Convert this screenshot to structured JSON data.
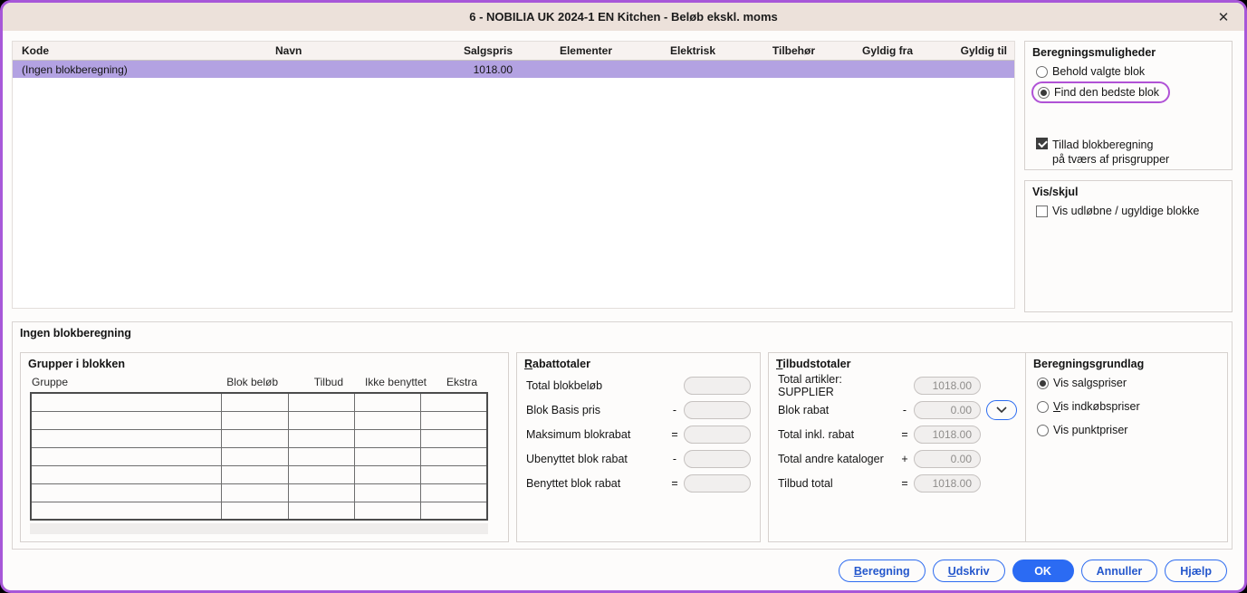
{
  "dialog": {
    "title": "6 - NOBILIA UK 2024-1 EN Kitchen - Beløb ekskl. moms",
    "close_icon": "✕"
  },
  "colors": {
    "accent_purple": "#a757d8",
    "selection_purple": "#b3a2e2",
    "primary_blue": "#2b6bf3",
    "titlebar_beige": "#ece1da"
  },
  "block_list": {
    "columns": [
      "Kode",
      "Navn",
      "Salgspris",
      "Elementer",
      "Elektrisk",
      "Tilbehør",
      "Gyldig fra",
      "Gyldig til"
    ],
    "rows": [
      {
        "kode": "(Ingen blokberegning)",
        "navn": "",
        "salgspris": "1018.00",
        "elementer": "",
        "elektrisk": "",
        "tilbehor": "",
        "gyldig_fra": "",
        "gyldig_til": "",
        "selected": true
      }
    ]
  },
  "beregningsmuligheder": {
    "title": "Beregningsmuligheder",
    "options": [
      {
        "label": "Behold valgte blok",
        "selected": false,
        "highlighted": false
      },
      {
        "label": "Find den bedste blok",
        "selected": true,
        "highlighted": true
      }
    ],
    "checkbox": {
      "line1": "Tillad blokberegning",
      "line2": "på tværs af prisgrupper",
      "checked": true
    }
  },
  "vis_skjul": {
    "title": "Vis/skjul",
    "checkbox": {
      "label": "Vis udløbne / ugyldige blokke",
      "checked": false
    }
  },
  "detail_panel": {
    "title": "Ingen blokberegning",
    "grupper": {
      "title": "Grupper i blokken",
      "columns": [
        "Gruppe",
        "Blok beløb",
        "Tilbud",
        "Ikke benyttet",
        "Ekstra"
      ],
      "row_count": 7,
      "rows": []
    },
    "rabattotaler": {
      "title": "Rabattotaler",
      "rows": [
        {
          "label": "Total blokbeløb",
          "op": "",
          "value": ""
        },
        {
          "label": "Blok Basis pris",
          "op": "-",
          "value": ""
        },
        {
          "label": "Maksimum blokrabat",
          "op": "=",
          "value": ""
        },
        {
          "label": "Ubenyttet blok rabat",
          "op": "-",
          "value": ""
        },
        {
          "label": "Benyttet blok rabat",
          "op": "=",
          "value": ""
        }
      ]
    },
    "tilbudstotaler": {
      "title": "Tilbudstotaler",
      "rows": [
        {
          "label": "Total artikler: SUPPLIER",
          "op": "",
          "value": "1018.00",
          "has_dropdown": false
        },
        {
          "label": "Blok rabat",
          "op": "-",
          "value": "0.00",
          "has_dropdown": true
        },
        {
          "label": "Total inkl. rabat",
          "op": "=",
          "value": "1018.00",
          "has_dropdown": false
        },
        {
          "label": "Total andre kataloger",
          "op": "+",
          "value": "0.00",
          "has_dropdown": false
        },
        {
          "label": "Tilbud total",
          "op": "=",
          "value": "1018.00",
          "has_dropdown": false
        }
      ]
    },
    "beregningsgrundlag": {
      "title": "Beregningsgrundlag",
      "options": [
        {
          "label": "Vis salgspriser",
          "selected": true
        },
        {
          "label": "Vis indkøbspriser",
          "selected": false
        },
        {
          "label": "Vis punktpriser",
          "selected": false
        }
      ]
    }
  },
  "footer": {
    "buttons": [
      {
        "label": "Beregning",
        "primary": false
      },
      {
        "label": "Udskriv",
        "primary": false
      },
      {
        "label": "OK",
        "primary": true
      },
      {
        "label": "Annuller",
        "primary": false
      },
      {
        "label": "Hjælp",
        "primary": false
      }
    ]
  }
}
